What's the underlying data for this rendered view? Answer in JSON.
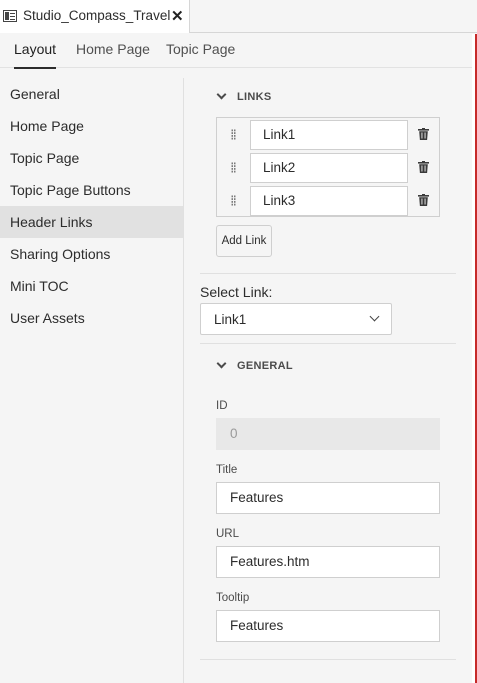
{
  "document": {
    "title": "Studio_Compass_Travel",
    "close_glyph": "✕"
  },
  "top_tabs": [
    {
      "label": "Layout",
      "active": true
    },
    {
      "label": "Home Page",
      "active": false
    },
    {
      "label": "Topic Page",
      "active": false
    }
  ],
  "sidebar": {
    "items": [
      {
        "label": "General"
      },
      {
        "label": "Home Page"
      },
      {
        "label": "Topic Page"
      },
      {
        "label": "Topic Page Buttons"
      },
      {
        "label": "Header Links",
        "active": true
      },
      {
        "label": "Sharing Options"
      },
      {
        "label": "Mini TOC"
      },
      {
        "label": "User Assets"
      }
    ]
  },
  "links_section": {
    "header": "LINKS",
    "links": [
      {
        "value": "Link1"
      },
      {
        "value": "Link2"
      },
      {
        "value": "Link3"
      }
    ],
    "add_button": "Add Link"
  },
  "select_link": {
    "label": "Select Link:",
    "value": "Link1"
  },
  "general_section": {
    "header": "GENERAL",
    "id": {
      "label": "ID",
      "value": "0"
    },
    "title": {
      "label": "Title",
      "value": "Features"
    },
    "url": {
      "label": "URL",
      "value": "Features.htm"
    },
    "tooltip": {
      "label": "Tooltip",
      "value": "Features"
    }
  },
  "colors": {
    "active_nav_bg": "#e1e1e1",
    "preview_edge": "#c62a2a",
    "trash": "#3a3a3a"
  },
  "icons": [
    "document-icon",
    "close-icon",
    "chevron-down-icon",
    "drag-handle-icon",
    "trash-icon"
  ]
}
